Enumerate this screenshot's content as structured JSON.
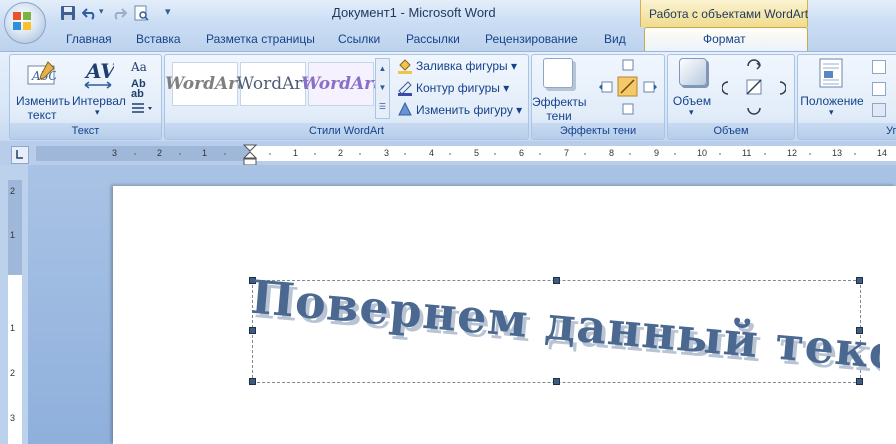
{
  "window": {
    "title": "Документ1 - Microsoft Word",
    "context_tab_title": "Работа с объектами WordArt"
  },
  "tabs": [
    "Главная",
    "Вставка",
    "Разметка страницы",
    "Ссылки",
    "Рассылки",
    "Рецензирование",
    "Вид",
    "Формат"
  ],
  "active_tab": "Формат",
  "ribbon": {
    "text_group": {
      "label": "Текст",
      "edit_text": "Изменить\nтекст",
      "spacing": "Интервал"
    },
    "styles_group": {
      "label": "Стили WordArt",
      "style_samples": [
        "WordArt",
        "WordArt",
        "WordArt"
      ],
      "fill": "Заливка фигуры",
      "outline": "Контур фигуры",
      "change_shape": "Изменить фигуру"
    },
    "shadow_group": {
      "label": "Эффекты тени",
      "shadow_effects": "Эффекты\nтени"
    },
    "volume_group": {
      "label": "Объем",
      "volume": "Объем"
    },
    "arrange_group": {
      "label": "Уп",
      "position": "Положение"
    }
  },
  "ruler": {
    "ticks": [
      "3",
      "2",
      "1",
      "1",
      "2",
      "3",
      "4",
      "5",
      "6",
      "7",
      "8",
      "9",
      "10",
      "11",
      "12",
      "13",
      "14"
    ]
  },
  "vruler": {
    "ticks": [
      "2",
      "1",
      "1",
      "2",
      "3"
    ]
  },
  "document": {
    "wordart_text": "Повернем данный текст."
  },
  "colors": {
    "wordart_fill": "#4a6890",
    "wordart_shadow": "#b8c4d4",
    "ribbon_text": "#15428b"
  }
}
